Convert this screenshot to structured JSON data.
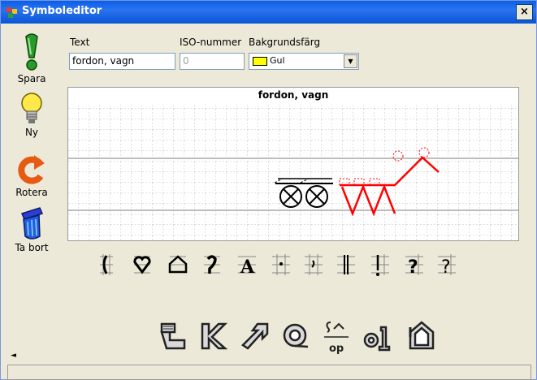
{
  "window": {
    "title": "Symboleditor",
    "close_glyph": "×"
  },
  "toolbar": {
    "save_label": "Spara",
    "new_label": "Ny",
    "rotate_label": "Rotera",
    "delete_label": "Ta bort",
    "save_icon": "exclamation-icon",
    "new_icon": "lightbulb-icon",
    "rotate_icon": "rotate-icon",
    "delete_icon": "trash-icon"
  },
  "form": {
    "text_label": "Text",
    "text_value": "fordon, vagn",
    "iso_label": "ISO-nummer",
    "iso_value": "0",
    "bg_label": "Bakgrundsfärg",
    "bg_value": "Gul",
    "bg_color": "#ffff00"
  },
  "canvas": {
    "title": "fordon, vagn"
  },
  "glyph_palette": [
    "gate-glyph",
    "heart-glyph",
    "house-glyph",
    "question-curve-glyph",
    "letter-a-glyph",
    "dot-glyph",
    "comma-glyph",
    "double-bar-glyph",
    "bar-glyph",
    "question-glyph",
    "question-outline-glyph"
  ],
  "bottom_tools": [
    "edit-tool",
    "back-arrow-tool",
    "forward-arrow-tool",
    "spiral-tool",
    "arrow-op-tool",
    "ol-tool",
    "house-outline-tool"
  ],
  "bottom_op_text": "op",
  "bottom_ol_text": "ol"
}
